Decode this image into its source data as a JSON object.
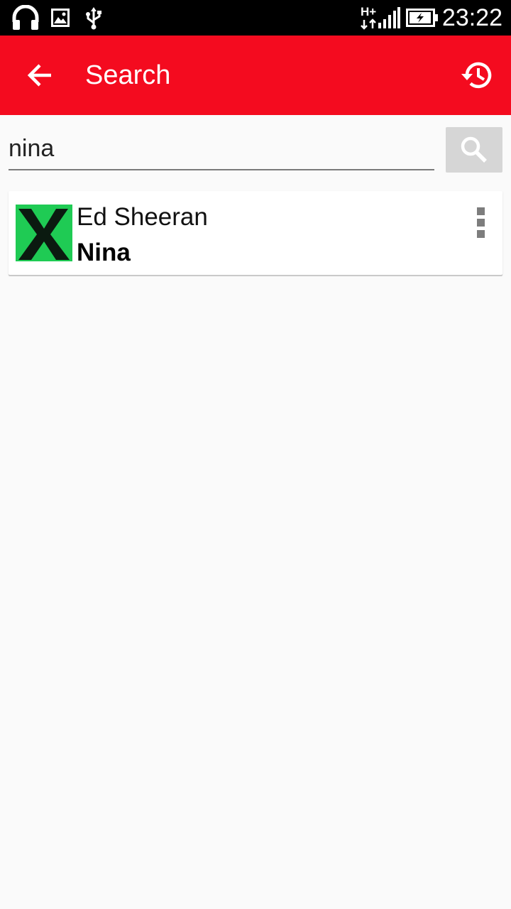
{
  "status_bar": {
    "time": "23:22",
    "network": "H+",
    "icons": [
      "headphones-icon",
      "image-icon",
      "usb-icon",
      "signal-icon",
      "battery-charging-icon"
    ]
  },
  "app_bar": {
    "title": "Search",
    "back_icon": "arrow-back-icon",
    "history_icon": "history-icon",
    "color": "#f40b1f"
  },
  "search": {
    "query": "nina",
    "button_icon": "search-icon"
  },
  "results": [
    {
      "artist": "Ed Sheeran",
      "title": "Nina",
      "cover_icon": "album-cover-x",
      "cover_color": "#1fcb54",
      "menu_icon": "more-vert-icon"
    }
  ]
}
